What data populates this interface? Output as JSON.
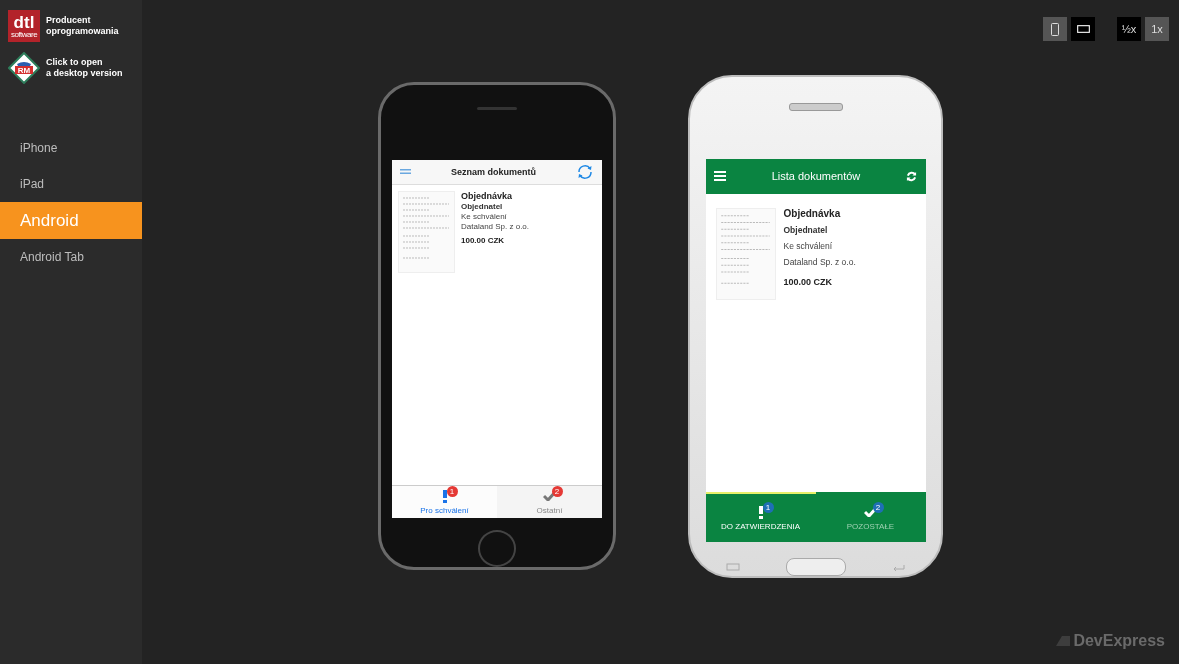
{
  "sidebar": {
    "logo": {
      "mark": "dtl",
      "sub": "software",
      "caption": [
        "Producent",
        "oprogramowania"
      ]
    },
    "desktop_link": {
      "mark": "RM",
      "caption": [
        "Click to open",
        "a desktop version"
      ]
    },
    "items": [
      {
        "label": "iPhone",
        "selected": false
      },
      {
        "label": "iPad",
        "selected": false
      },
      {
        "label": "Android",
        "selected": true
      },
      {
        "label": "Android Tab",
        "selected": false
      }
    ]
  },
  "toolbar": {
    "orientation": [
      {
        "kind": "portrait",
        "selected": true
      },
      {
        "kind": "landscape",
        "selected": false
      }
    ],
    "scale": [
      {
        "label": "½x",
        "selected": false
      },
      {
        "label": "1x",
        "selected": true
      }
    ]
  },
  "devices": [
    {
      "kind": "iphone",
      "title": "Seznam dokumentů",
      "documents": [
        {
          "title": "Objednávka",
          "subtitle": "Objednatel",
          "status": "Ke schválení",
          "company": "Dataland Sp. z o.o.",
          "amount": "100.00 CZK"
        }
      ],
      "tabs": [
        {
          "kind": "exclamation",
          "label": "Pro schválení",
          "badge": "1",
          "selected": true
        },
        {
          "kind": "check",
          "label": "Ostatní",
          "badge": "2",
          "selected": false
        }
      ]
    },
    {
      "kind": "android",
      "title": "Lista dokumentów",
      "documents": [
        {
          "title": "Objednávka",
          "subtitle": "Objednatel",
          "status": "Ke schválení",
          "company": "Dataland Sp. z o.o.",
          "amount": "100.00 CZK"
        }
      ],
      "tabs": [
        {
          "kind": "exclamation",
          "label": "DO ZATWIERDZENIA",
          "badge": "1",
          "selected": true
        },
        {
          "kind": "check",
          "label": "POZOSTAŁE",
          "badge": "2",
          "selected": false
        }
      ]
    }
  ],
  "brand": "DevExpress"
}
